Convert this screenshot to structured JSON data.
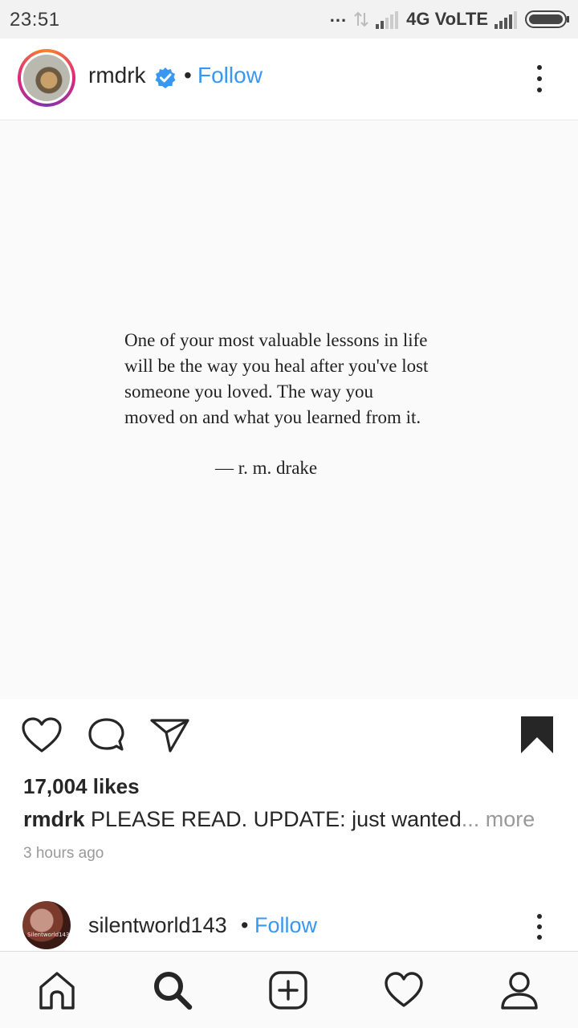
{
  "status_bar": {
    "time": "23:51",
    "dots": "...",
    "network": "4G VoLTE"
  },
  "post": {
    "username": "rmdrk",
    "separator": "•",
    "follow_label": "Follow",
    "quote_lines": [
      "One of your most valuable lessons in life",
      "will be the way you heal after you've lost",
      "someone you loved. The way you",
      "moved on and what you learned from it."
    ],
    "quote_author": "— r. m. drake",
    "likes": "17,004 likes",
    "caption_user": "rmdrk",
    "caption_text": " PLEASE READ. UPDATE: just wanted",
    "caption_more": "... more",
    "timestamp": "3 hours ago"
  },
  "next_post": {
    "username": "silentworld143",
    "avatar_text": "Silentworld143",
    "separator": "•",
    "follow_label": "Follow"
  },
  "icons": {
    "verified": "verified-badge-icon",
    "like": "heart-icon",
    "comment": "comment-icon",
    "share": "send-icon",
    "save": "bookmark-icon",
    "more": "more-vertical-icon",
    "nav": [
      "home-icon",
      "search-icon",
      "add-post-icon",
      "activity-heart-icon",
      "profile-icon"
    ]
  },
  "colors": {
    "link": "#3897f0",
    "text": "#262626",
    "muted": "#999999"
  }
}
